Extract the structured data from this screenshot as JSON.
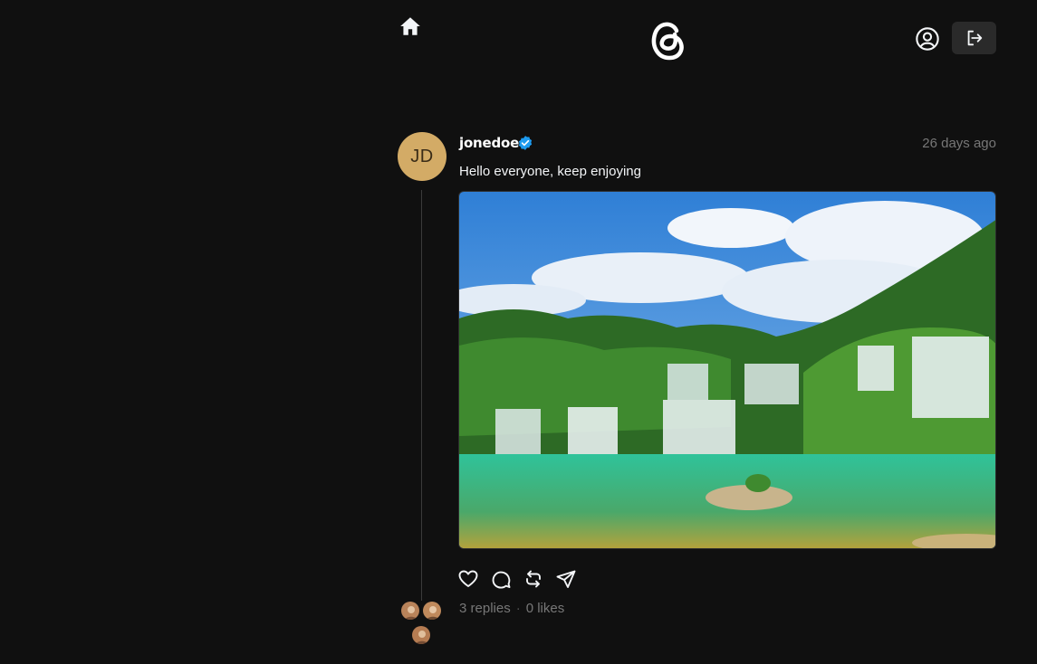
{
  "header": {
    "home_icon": "home-icon",
    "logo_icon": "threads-logo-icon",
    "profile_icon": "user-circle-icon",
    "logout_icon": "logout-icon"
  },
  "post": {
    "avatar_initials": "JD",
    "username": "jonedoe",
    "verified_icon": "verified-badge-icon",
    "timestamp": "26 days ago",
    "text": "Hello everyone, keep enjoying",
    "image_icon": "waterfall-photo",
    "actions": [
      "heart-icon",
      "comment-icon",
      "repost-icon",
      "share-icon"
    ],
    "replies_label": "3 replies",
    "separator": "·",
    "likes_label": "0 likes"
  },
  "colors": {
    "background": "#101010",
    "avatar": "#d3ab66",
    "verified": "#1d9bf0",
    "muted_text": "#777777"
  }
}
